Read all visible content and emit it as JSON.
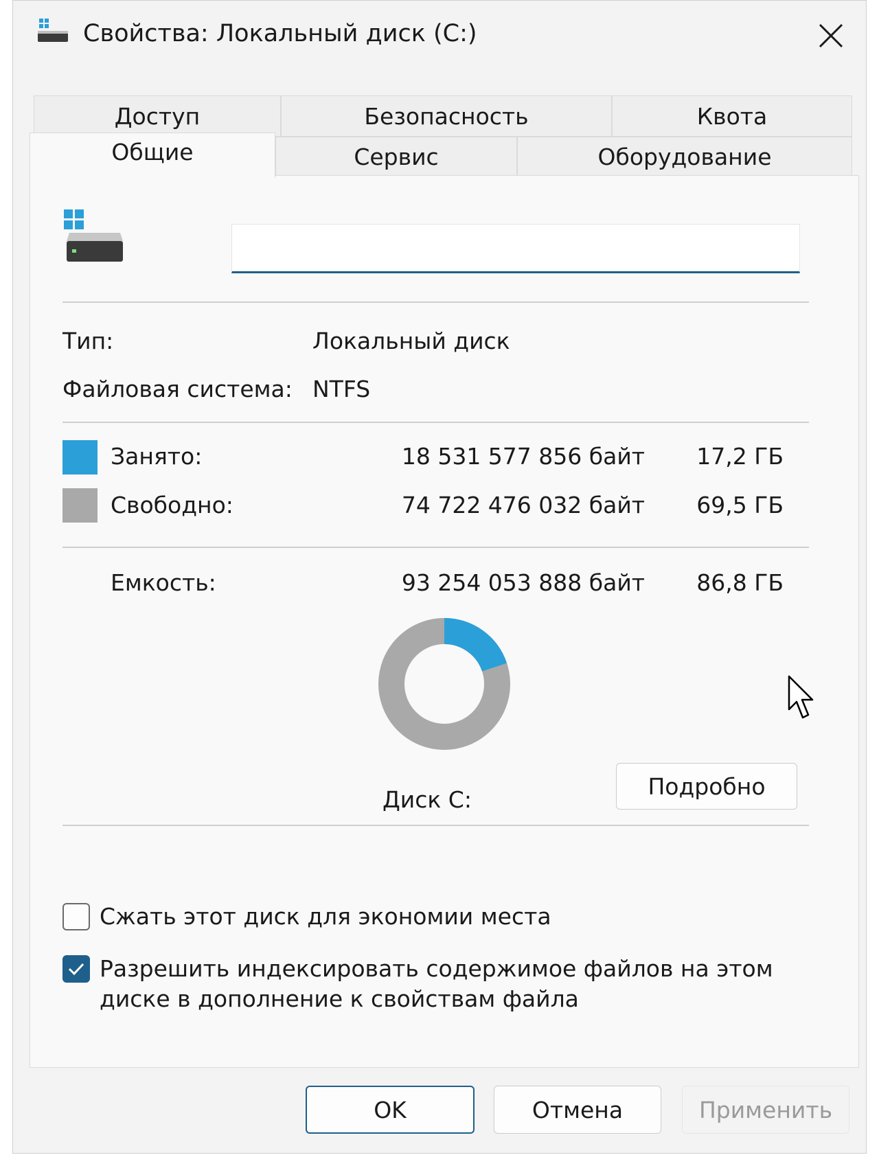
{
  "window": {
    "title": "Свойства: Локальный диск (C:)"
  },
  "tabs": {
    "row1": [
      {
        "label": "Доступ"
      },
      {
        "label": "Безопасность"
      },
      {
        "label": "Квота"
      }
    ],
    "row2": [
      {
        "label": "Общие",
        "active": true
      },
      {
        "label": "Сервис"
      },
      {
        "label": "Оборудование"
      }
    ]
  },
  "general": {
    "name_value": "",
    "type_label": "Тип:",
    "type_value": "Локальный диск",
    "fs_label": "Файловая система:",
    "fs_value": "NTFS",
    "used": {
      "label": "Занято:",
      "bytes": "18 531 577 856 байт",
      "size": "17,2 ГБ",
      "color": "#2b9fd8",
      "value_bytes": 18531577856
    },
    "free": {
      "label": "Свободно:",
      "bytes": "74 722 476 032 байт",
      "size": "69,5 ГБ",
      "color": "#a9a9a9",
      "value_bytes": 74722476032
    },
    "capacity": {
      "label": "Емкость:",
      "bytes": "93 254 053 888 байт",
      "size": "86,8 ГБ"
    },
    "disk_label": "Диск C:",
    "details_button": "Подробно",
    "compress_label": "Сжать этот диск для экономии места",
    "compress_checked": false,
    "index_label_line1": "Разрешить индексировать содержимое файлов на этом",
    "index_label_line2": "диске в дополнение к свойствам файла",
    "index_checked": true
  },
  "buttons": {
    "ok": "OK",
    "cancel": "Отмена",
    "apply": "Применить"
  },
  "colors": {
    "accent": "#1f5f8b",
    "used": "#2b9fd8",
    "free": "#a9a9a9"
  }
}
